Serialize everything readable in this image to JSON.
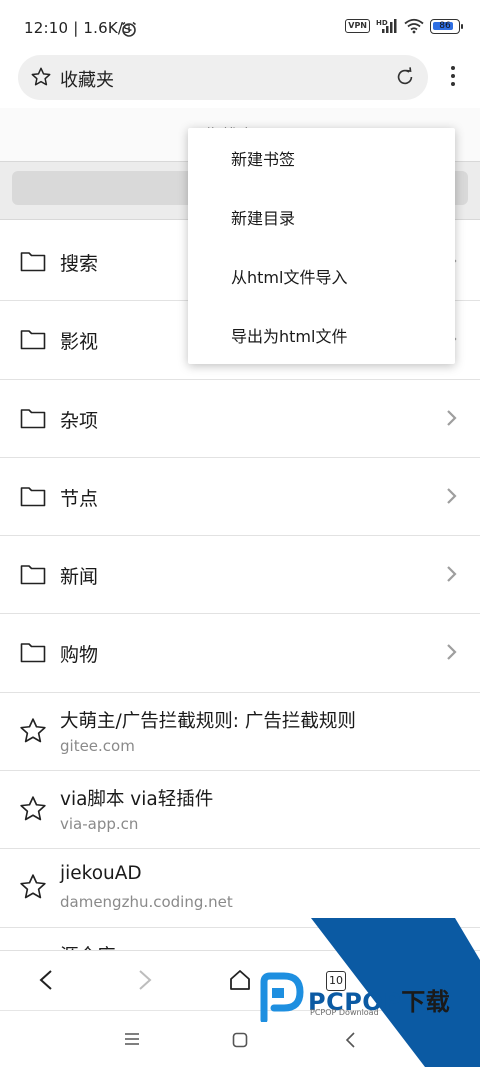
{
  "status_bar": {
    "time_speed": "12:10 | 1.6K/s",
    "vpn": "VPN",
    "network": "HD",
    "battery": "86",
    "battery_level": 0.86
  },
  "address_bar": {
    "title": "收藏夹"
  },
  "toolbar": {
    "partial_label": "日期排序"
  },
  "folders": [
    {
      "label": "搜索"
    },
    {
      "label": "影视"
    },
    {
      "label": "杂项"
    },
    {
      "label": "节点"
    },
    {
      "label": "新闻"
    },
    {
      "label": "购物"
    }
  ],
  "bookmarks": [
    {
      "title": "大萌主/广告拦截规则: 广告拦截规则",
      "url": "gitee.com"
    },
    {
      "title": "via脚本 via轻插件",
      "url": "via-app.cn"
    },
    {
      "title": "jiekouAD",
      "url": "damengzhu.coding.net"
    },
    {
      "title": "源仓库",
      "url": ""
    }
  ],
  "bottom_nav": {
    "tab_count": "10"
  },
  "popup_menu": {
    "items": [
      "新建书签",
      "新建目录",
      "从html文件导入",
      "导出为html文件"
    ]
  },
  "watermark": {
    "brand": "PCPOP",
    "brand_cn": "下载",
    "sub": "PCPOP Download"
  },
  "colors": {
    "accent_blue": "#0b5aa3",
    "battery_blue": "#2f6fe3"
  }
}
